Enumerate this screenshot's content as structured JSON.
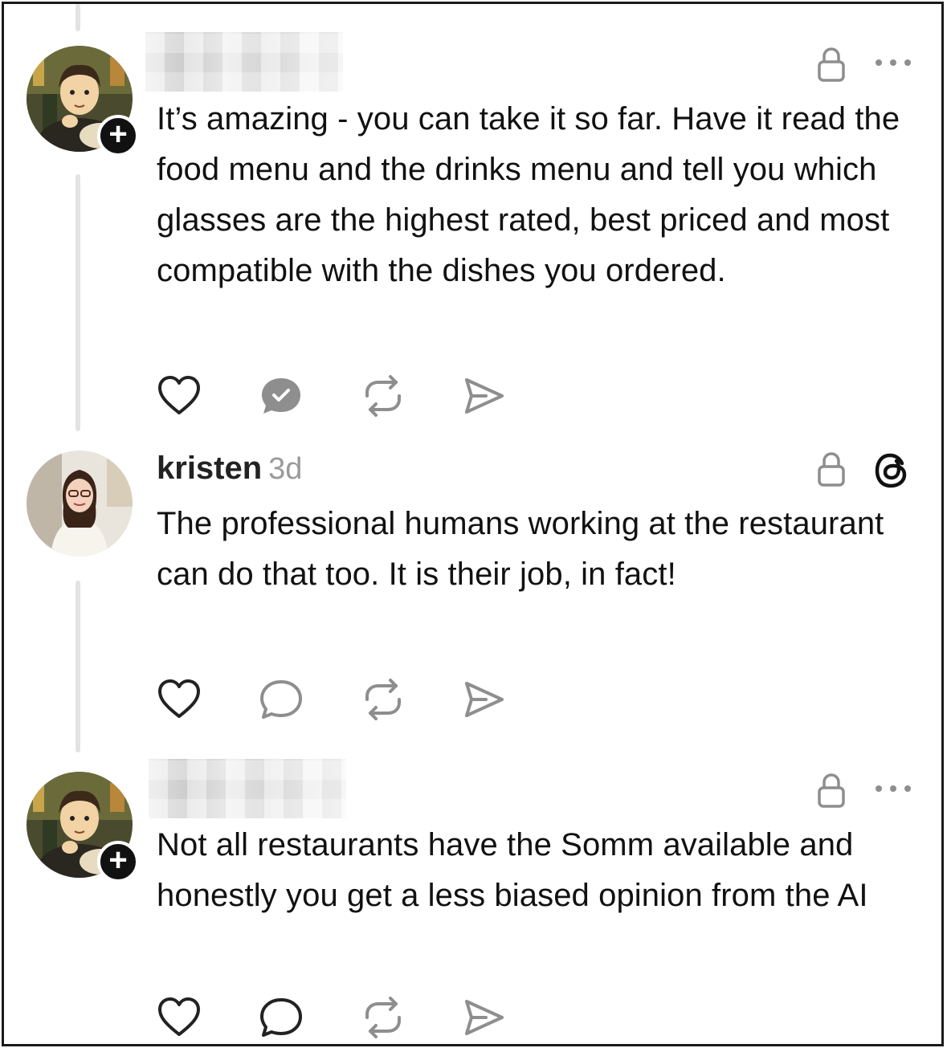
{
  "posts": [
    {
      "username": "",
      "username_blurred": true,
      "time": "",
      "text": "It’s amazing - you can take it so far. Have it read the food menu and the drinks menu and tell you which glasses are the highest rated, best priced and most compatible with the dishes you ordered.",
      "icons": [
        "heart-icon",
        "reply-filled-check-icon",
        "repost-icon",
        "share-icon"
      ],
      "header_icons": [
        "lock-icon",
        "more-icon"
      ]
    },
    {
      "username": "kristen",
      "time": "3d",
      "text": "The professional humans working at the restaurant can do that too. It is their job, in fact!",
      "icons": [
        "heart-icon",
        "reply-icon",
        "repost-icon",
        "share-icon"
      ],
      "header_icons": [
        "lock-icon",
        "threads-logo-icon"
      ]
    },
    {
      "username": "",
      "username_blurred": true,
      "time": "",
      "text": "Not all restaurants have the Somm available and honestly you get a less biased opinion from the AI",
      "icons": [
        "heart-icon",
        "reply-icon",
        "repost-icon",
        "share-icon"
      ],
      "header_icons": [
        "lock-icon",
        "more-icon"
      ]
    }
  ],
  "colors": {
    "text": "#111111",
    "muted": "#9a9a9a",
    "icon_dark": "#222222",
    "icon_gray": "#8e8e8e",
    "thread_line": "#e3e3e3"
  }
}
